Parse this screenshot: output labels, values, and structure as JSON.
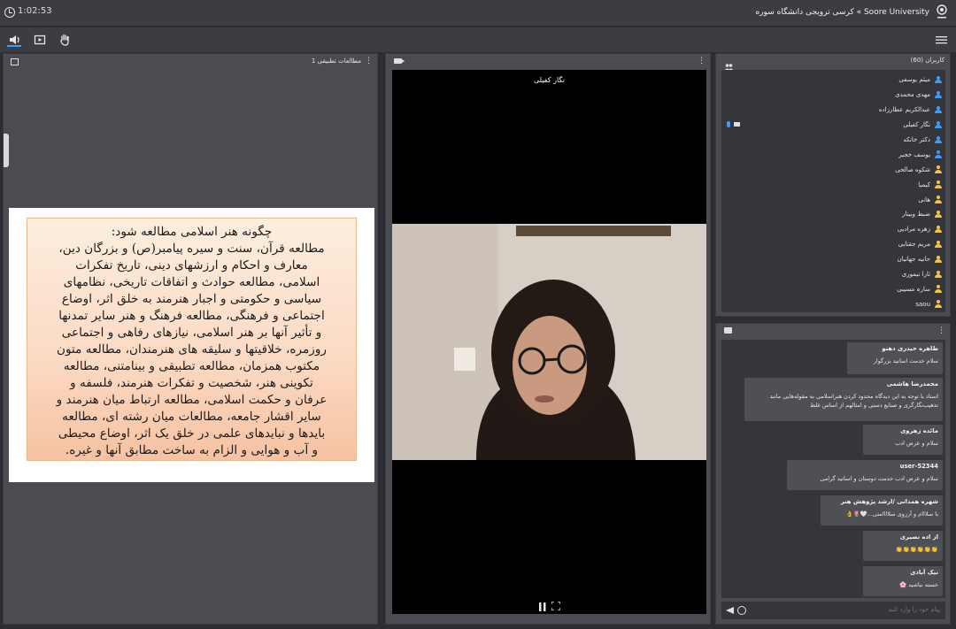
{
  "topbar": {
    "clock": "1:02:53",
    "room_title": "Soore University » کرسی ترویجی دانشگاه سوره"
  },
  "doc_panel": {
    "title": "مطالعات تطبیقی 1",
    "slide_lines": [
      "چگونه هنر اسلامی مطالعه شود:",
      "مطالعه قرآن، سنت و سیره پیامبر(ص) و بزرگان دین،",
      "معارف و احکام و ارزشهای دینی، تاریخ تفکرات",
      "اسلامی، مطالعه حوادث و اتفاقات تاریخی، نظامهای",
      "سیاسی و حکومتی و اجبار هنرمند به خلق اثر، اوضاع",
      "اجتماعی و فرهنگی، مطالعه فرهنگ و هنر سایر تمدنها",
      "و تأثیر آنها بر هنر اسلامی، نیازهای رفاهی و اجتماعی",
      "روزمره، خلاقیتها و سلیقه های هنرمندان، مطالعه متون",
      "مکتوب همزمان، مطالعه تطبیقی و بینامتنی، مطالعه",
      "تکوینی هنر، شخصیت و تفکرات هنرمند، فلسفه و",
      "عرفان و حکمت اسلامی، مطالعه ارتباط میان هنرمند و",
      "سایر اقشار جامعه، مطالعات میان رشته ای، مطالعه",
      "بایدها و نبایدهای علمی در خلق یک اثر، اوضاع محیطی",
      "و آب و هوایی و الزام به ساخت مطابق آنها و غیره."
    ]
  },
  "video_panel": {
    "camera_name": "نگار کفیلی"
  },
  "users_panel": {
    "title": "کاربران (60)",
    "users": [
      {
        "name": "میثم یوسفی",
        "color": "#3b9cff",
        "media": false
      },
      {
        "name": "مهدی محمدی",
        "color": "#3b9cff",
        "media": false
      },
      {
        "name": "عبدالکریم عطارزاده",
        "color": "#3b9cff",
        "media": false
      },
      {
        "name": "نگار کفیلی",
        "color": "#3b9cff",
        "media": true
      },
      {
        "name": "دکتر خانکه",
        "color": "#3b9cff",
        "media": false
      },
      {
        "name": "یوسف خجیر",
        "color": "#3b9cff",
        "media": false
      },
      {
        "name": "شکوه صالحی",
        "color": "#f5c542",
        "media": false
      },
      {
        "name": "کیمیا",
        "color": "#f5c542",
        "media": false
      },
      {
        "name": "هانی",
        "color": "#f5c542",
        "media": false
      },
      {
        "name": "ضبط وبینار",
        "color": "#f5c542",
        "media": false
      },
      {
        "name": "زهره مرادیی",
        "color": "#f5c542",
        "media": false
      },
      {
        "name": "مریم جقتایی",
        "color": "#f5c542",
        "media": false
      },
      {
        "name": "حانیه جهانیان",
        "color": "#f5c542",
        "media": false
      },
      {
        "name": "ثارا تیموری",
        "color": "#f5c542",
        "media": false
      },
      {
        "name": "سارہ مسیبی",
        "color": "#f5c542",
        "media": false
      },
      {
        "name": "saou",
        "color": "#f5c542",
        "media": false
      }
    ]
  },
  "chat_panel": {
    "messages": [
      {
        "author": "طاهره حیدری دهنو",
        "text": "سلام خدمت اساتید بزرگوار",
        "emoji": ""
      },
      {
        "author": "محمدرضا هاشمی",
        "text": "استاد با توجه به این دیدگاه محدود کردن هنراسلامی به مقوله‌هایی مانند تذهیب‌نگارگری و صنایع دستی و امثالهم از اساس غلط",
        "emoji": ""
      },
      {
        "author": "مائده زهروی",
        "text": "سلام و عرض ادب",
        "emoji": ""
      },
      {
        "author": "user-52344",
        "text": "سلام و عرض ادب خدمت دوستان و اساتید گرامی",
        "emoji": ""
      },
      {
        "author": "شهره همدانی /ارشد پژوهش هنر",
        "text": "با سلااام و آرزوی سلاااامتی...🤍🌷👌",
        "emoji": ""
      },
      {
        "author": "از اده نصیری",
        "text": "",
        "emoji": "👏👏👏👏👏👏"
      },
      {
        "author": "نیک آبادی",
        "text": "خسته نباشید 🌸",
        "emoji": ""
      }
    ],
    "input_placeholder": "پیام خود را وارد کنید"
  }
}
